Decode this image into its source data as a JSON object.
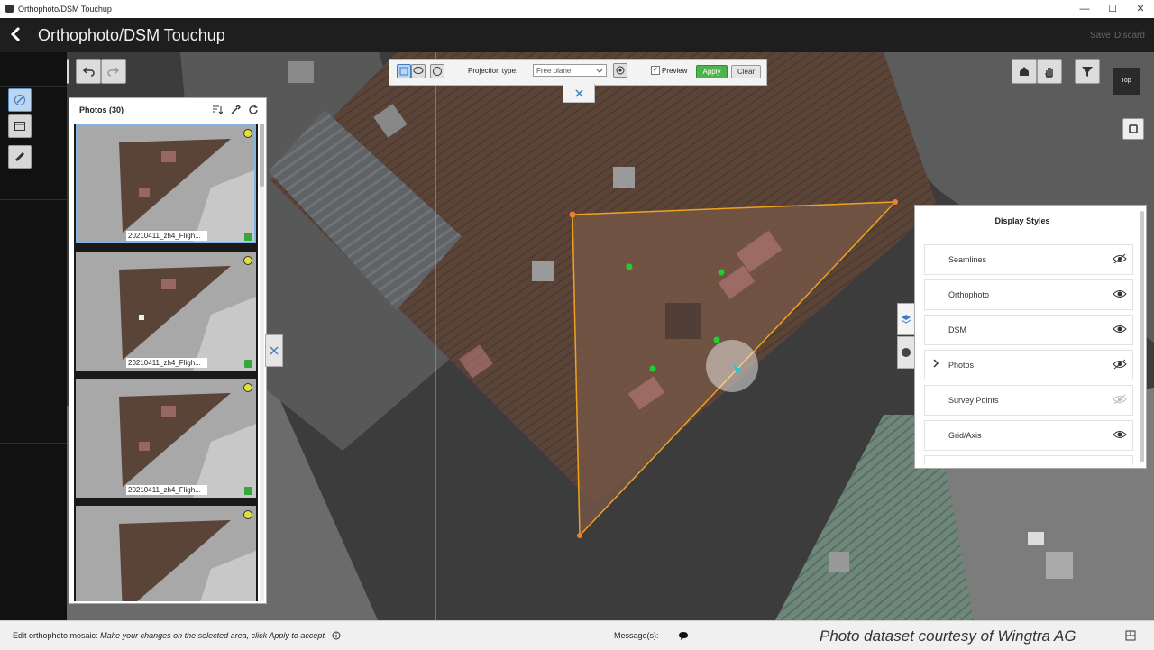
{
  "window": {
    "title": "Orthophoto/DSM Touchup",
    "minimize": "—",
    "maximize": "☐",
    "close": "✕"
  },
  "header": {
    "title": "Orthophoto/DSM Touchup",
    "save_label": "Save",
    "discard_label": "Discard"
  },
  "photos_panel": {
    "title": "Photos (30)",
    "items": [
      {
        "label": "20210411_zh4_Fligh..."
      },
      {
        "label": "20210411_zh4_Fligh..."
      },
      {
        "label": "20210411_zh4_Fligh..."
      },
      {
        "label": ""
      }
    ]
  },
  "projection_toolbar": {
    "projection_label": "Projection type:",
    "projection_value": "Free plane",
    "preview_label": "Preview",
    "preview_checked": true,
    "apply_label": "Apply",
    "clear_label": "Clear"
  },
  "view": {
    "top_label": "Top"
  },
  "display_styles": {
    "title": "Display Styles",
    "items": [
      {
        "label": "Seamlines",
        "visibility": "hidden",
        "expandable": false
      },
      {
        "label": "Orthophoto",
        "visibility": "visible",
        "expandable": false
      },
      {
        "label": "DSM",
        "visibility": "visible",
        "expandable": false
      },
      {
        "label": "Photos",
        "visibility": "hidden",
        "expandable": true
      },
      {
        "label": "Survey Points",
        "visibility": "disabled",
        "expandable": false
      },
      {
        "label": "Grid/Axis",
        "visibility": "visible",
        "expandable": false
      }
    ]
  },
  "status": {
    "prefix": "Edit orthophoto mosaic:",
    "instruction": "Make your changes on the selected area, click Apply to accept.",
    "messages_label": "Message(s):",
    "credit": "Photo dataset courtesy of  Wingtra AG"
  },
  "colors": {
    "accent_blue": "#3f7bc0",
    "apply_green": "#4db34a",
    "selection_orange": "#f0a020",
    "marker_green": "#22cc33",
    "marker_cyan": "#20c8d8"
  }
}
